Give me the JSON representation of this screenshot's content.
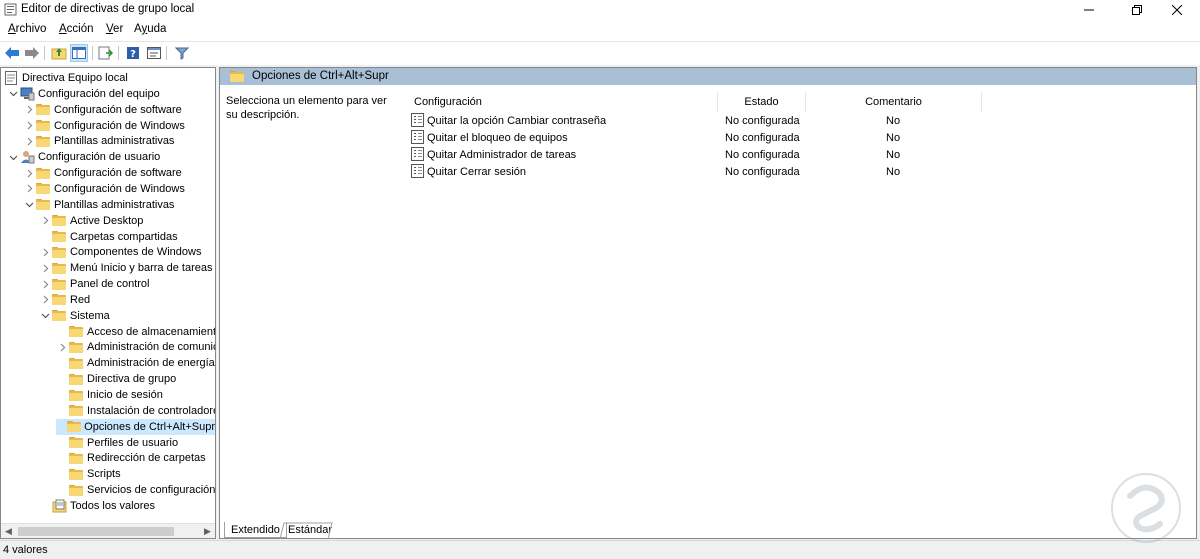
{
  "window": {
    "title": "Editor de directivas de grupo local"
  },
  "menu": [
    {
      "label": "Archivo",
      "accel": "A",
      "rest": "rchivo"
    },
    {
      "label": "Acción",
      "accel": "A",
      "rest": "cción"
    },
    {
      "label": "Ver",
      "accel": "V",
      "rest": "er"
    },
    {
      "label": "Ayuda",
      "accel": "y",
      "pre": "A",
      "rest": "uda"
    }
  ],
  "toolbar": {
    "icons": [
      "back-arrow-icon",
      "forward-arrow-icon",
      "up-folder-icon",
      "show-hide-tree-icon",
      "export-list-icon",
      "help-icon",
      "properties-icon",
      "filter-icon"
    ]
  },
  "tree": {
    "items": [
      {
        "label": "Directiva Equipo local",
        "level": 0,
        "chevron": "",
        "icon": "policy-doc-icon"
      },
      {
        "label": "Configuración del equipo",
        "level": 1,
        "chevron": "down",
        "icon": "computer-icon"
      },
      {
        "label": "Configuración de software",
        "level": 2,
        "chevron": "right",
        "icon": "folder-icon"
      },
      {
        "label": "Configuración de Windows",
        "level": 2,
        "chevron": "right",
        "icon": "folder-icon"
      },
      {
        "label": "Plantillas administrativas",
        "level": 2,
        "chevron": "right",
        "icon": "folder-icon"
      },
      {
        "label": "Configuración de usuario",
        "level": 1,
        "chevron": "down",
        "icon": "user-icon"
      },
      {
        "label": "Configuración de software",
        "level": 2,
        "chevron": "right",
        "icon": "folder-icon"
      },
      {
        "label": "Configuración de Windows",
        "level": 2,
        "chevron": "right",
        "icon": "folder-icon"
      },
      {
        "label": "Plantillas administrativas",
        "level": 2,
        "chevron": "down",
        "icon": "folder-icon"
      },
      {
        "label": "Active Desktop",
        "level": 3,
        "chevron": "right",
        "icon": "folder-icon"
      },
      {
        "label": "Carpetas compartidas",
        "level": 3,
        "chevron": "",
        "icon": "folder-icon"
      },
      {
        "label": "Componentes de Windows",
        "level": 3,
        "chevron": "right",
        "icon": "folder-icon"
      },
      {
        "label": "Menú Inicio y barra de tareas",
        "level": 3,
        "chevron": "right",
        "icon": "folder-icon"
      },
      {
        "label": "Panel de control",
        "level": 3,
        "chevron": "right",
        "icon": "folder-icon"
      },
      {
        "label": "Red",
        "level": 3,
        "chevron": "right",
        "icon": "folder-icon"
      },
      {
        "label": "Sistema",
        "level": 3,
        "chevron": "down",
        "icon": "folder-icon"
      },
      {
        "label": "Acceso de almacenamiento",
        "level": 4,
        "chevron": "",
        "icon": "folder-icon"
      },
      {
        "label": "Administración de comunicaciones",
        "level": 4,
        "chevron": "right",
        "icon": "folder-icon"
      },
      {
        "label": "Administración de energía",
        "level": 4,
        "chevron": "",
        "icon": "folder-icon"
      },
      {
        "label": "Directiva de grupo",
        "level": 4,
        "chevron": "",
        "icon": "folder-icon"
      },
      {
        "label": "Inicio de sesión",
        "level": 4,
        "chevron": "",
        "icon": "folder-icon"
      },
      {
        "label": "Instalación de controladores",
        "level": 4,
        "chevron": "",
        "icon": "folder-icon"
      },
      {
        "label": "Opciones de Ctrl+Alt+Supr",
        "level": 4,
        "chevron": "",
        "icon": "folder-icon",
        "selected": true
      },
      {
        "label": "Perfiles de usuario",
        "level": 4,
        "chevron": "",
        "icon": "folder-icon"
      },
      {
        "label": "Redirección de carpetas",
        "level": 4,
        "chevron": "",
        "icon": "folder-icon"
      },
      {
        "label": "Scripts",
        "level": 4,
        "chevron": "",
        "icon": "folder-icon"
      },
      {
        "label": "Servicios de configuración",
        "level": 4,
        "chevron": "",
        "icon": "folder-icon"
      },
      {
        "label": "Todos los valores",
        "level": 3,
        "chevron": "",
        "icon": "all-settings-icon"
      }
    ]
  },
  "right": {
    "header_title": "Opciones de Ctrl+Alt+Supr",
    "description": "Selecciona un elemento para ver su descripción.",
    "columns": [
      "Configuración",
      "Estado",
      "Comentario"
    ],
    "rows": [
      {
        "name": "Quitar la opción Cambiar contraseña",
        "state": "No configurada",
        "comment": "No"
      },
      {
        "name": "Quitar el bloqueo de equipos",
        "state": "No configurada",
        "comment": "No"
      },
      {
        "name": "Quitar Administrador de tareas",
        "state": "No configurada",
        "comment": "No"
      },
      {
        "name": "Quitar Cerrar sesión",
        "state": "No configurada",
        "comment": "No"
      }
    ]
  },
  "tabs": [
    "Extendido",
    "Estándar"
  ],
  "status": {
    "text": "4 valores"
  },
  "colors": {
    "header_band": "#a9bfd6",
    "selection": "#cce8ff",
    "folder": "#f8d775"
  }
}
